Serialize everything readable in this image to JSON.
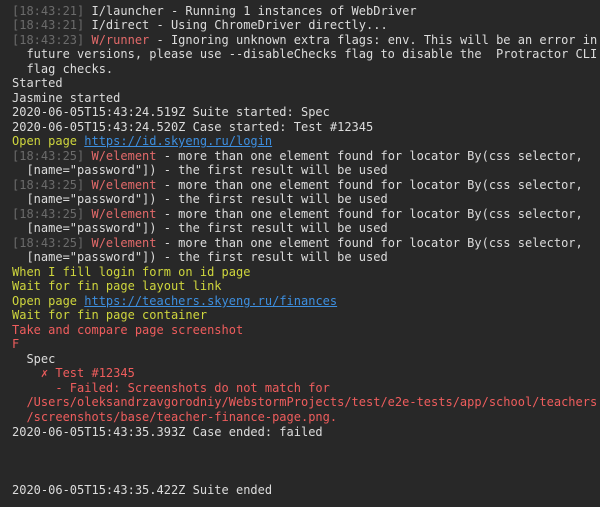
{
  "log": {
    "l1_ts": "[18:43:21]",
    "l1_rest": " I/launcher - Running 1 instances of WebDriver",
    "l2_ts": "[18:43:21]",
    "l2_rest": " I/direct - Using ChromeDriver directly...",
    "l3_ts": "[18:43:23]",
    "l3_warn": " W/runner",
    "l3_rest": " - Ignoring unknown extra flags: env. This will be an error in",
    "l3b": "  future versions, please use --disableChecks flag to disable the  Protractor CLI",
    "l3c": "  flag checks.",
    "started": "Started",
    "jasmine": "Jasmine started",
    "suite_started": "2020-06-05T15:43:24.519Z Suite started: Spec",
    "case_started": "2020-06-05T15:43:24.520Z Case started: Test #12345",
    "open_prefix": "Open page ",
    "open_url": "https://id.skyeng.ru/login",
    "w1_ts": "[18:43:25]",
    "w_label": " W/element",
    "w_rest": " - more than one element found for locator By(css selector,",
    "w_cont": "  [name=\"password\"]) - the first result will be used",
    "w2_ts": "[18:43:25]",
    "w3_ts": "[18:43:25]",
    "w4_ts": "[18:43:25]",
    "fill": "When I fill login form on id page",
    "wait_link": "Wait for fin page layout link",
    "open2_prefix": "Open page ",
    "open2_url": "https://teachers.skyeng.ru/finances",
    "wait_container": "Wait for fin page container",
    "take": "Take and compare page screenshot",
    "f": "F",
    "spec": "  Spec",
    "test_fail": "    ✗ Test #12345",
    "failed1": "      - Failed: Screenshots do not match for",
    "failed2": "  /Users/oleksandrzavgorodniy/WebstormProjects/test/e2e-tests/app/school/teachers",
    "failed3": "  /screenshots/base/teacher-finance-page.png.",
    "case_ended": "2020-06-05T15:43:35.393Z Case ended: failed",
    "suite_ended": "2020-06-05T15:43:35.422Z Suite ended"
  }
}
